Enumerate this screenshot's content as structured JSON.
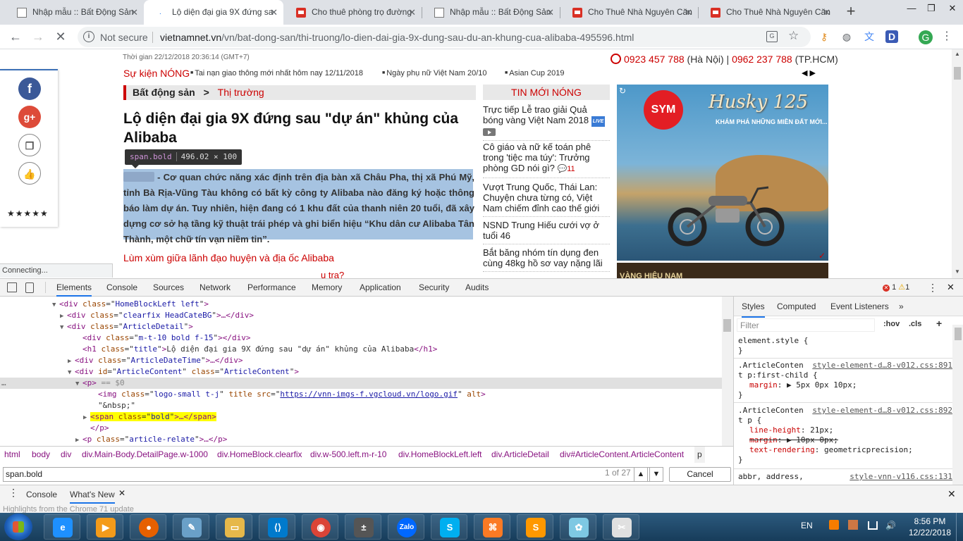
{
  "browser": {
    "tabs": [
      {
        "title": "Nhập mẫu :: Bất Động Sản",
        "favicon": "page-icon",
        "active": false
      },
      {
        "title": "Lộ diện đại gia 9X đứng sa",
        "favicon": "loading-icon",
        "active": true
      },
      {
        "title": "Cho thuê phòng trọ đường",
        "favicon": "red-site-icon",
        "active": false
      },
      {
        "title": "Nhập mẫu :: Bất Động Sản",
        "favicon": "page-icon",
        "active": false
      },
      {
        "title": "Cho Thuê Nhà Nguyên Căn",
        "favicon": "red-site-icon",
        "active": false
      },
      {
        "title": "Cho Thuê Nhà Nguyên Căn",
        "favicon": "red-site-icon",
        "active": false
      }
    ],
    "new_tab_label": "+",
    "window_controls": [
      "—",
      "❐",
      "✕"
    ],
    "security_text": "Not secure",
    "url_domain": "vietnamnet.vn",
    "url_path": "/vn/bat-dong-san/thi-truong/lo-dien-dai-gia-9x-dung-sau-du-an-khung-cua-alibaba-495596.html",
    "profile_initial": "G",
    "ext_d": "D",
    "status_text": "Connecting..."
  },
  "site": {
    "timeline": "Thời gian 22/12/2018 20:36:14 (GMT+7)",
    "hotline_hn": "0923 457 788",
    "hotline_hn_city": " (Hà Nội) | ",
    "hotline_hcm": "0962 237 788",
    "hotline_hcm_city": " (TP.HCM)",
    "su_kien": "Sự kiện NÓNG",
    "events": [
      "Tai nạn giao thông mới nhất hôm nay 12/11/2018",
      "Ngày phụ nữ Việt Nam 20/10",
      "Asian Cup 2019"
    ],
    "carousel_arrows": "◀ ▶",
    "breadcrumb_main": "Bất động sản",
    "breadcrumb_sep": ">",
    "breadcrumb_sub": "Thị trường",
    "title": "Lộ diện đại gia 9X đứng sau \"dự án\" khủng của Alibaba",
    "lead": " - Cơ quan chức năng xác định trên địa bàn xã Châu Pha, thị xã Phú Mỹ, tỉnh Bà Rịa-Vũng Tàu không có bất kỳ công ty Alibaba nào đăng ký hoặc thông báo làm dự án. Tuy nhiên, hiện đang có 1 khu đất của thanh niên 20 tuổi, đã xây dựng cơ sở hạ tầng kỹ thuật trái phép và ghi biển hiệu “Khu dân cư Alibaba Tân Thành, một chữ tín vạn niềm tin”.",
    "related_1": "Lùm xùm giữa lãnh đạo huyện và địa ốc Alibaba",
    "related_2": "u tra?",
    "social_stars": "★★★★★",
    "social_fb": "f",
    "social_gplus": "g+",
    "hot_news_header": "TIN MỚI NÓNG",
    "hot_news": [
      {
        "text": "Trực tiếp Lễ trao giải Quả bóng vàng Việt Nam 2018",
        "badge": "LIVE"
      },
      {
        "text": "Cô giáo và nữ kế toán phê trong 'tiệc ma túy': Trưởng phòng GD nói gì?",
        "comments": "11"
      },
      {
        "text": "Vượt Trung Quốc, Thái Lan: Chuyện chưa từng có, Việt Nam chiếm đỉnh cao thế giới"
      },
      {
        "text": "NSND Trung Hiếu cưới vợ ở tuổi 46"
      },
      {
        "text": "Bắt băng nhóm tín dụng đen cùng 48kg hồ sơ vay nặng lãi"
      }
    ],
    "ad_brand": "SYM",
    "ad_model": "Husky 125",
    "ad_slogan": "KHÁM PHÁ NHỮNG MIỀN ĐẤT MỚI...",
    "ad2_text": "VÀNG HIỆU NAM"
  },
  "inspect_tooltip": {
    "selector": "span.bold",
    "size": "496.02 × 100"
  },
  "devtools": {
    "tabs": [
      "Elements",
      "Console",
      "Sources",
      "Network",
      "Performance",
      "Memory",
      "Application",
      "Security",
      "Audits"
    ],
    "errors": "1",
    "warnings": "1",
    "dom_lines": [
      {
        "indent": 6,
        "tri": "▼",
        "tag": "div",
        "attrs": [
          [
            "class",
            "HomeBlockLeft left"
          ]
        ],
        "tail": ">"
      },
      {
        "indent": 7,
        "tri": "▶",
        "tag": "div",
        "attrs": [
          [
            "class",
            "clearfix HeadCateBG"
          ]
        ],
        "tail": ">…</div>"
      },
      {
        "indent": 7,
        "tri": "▼",
        "tag": "div",
        "attrs": [
          [
            "class",
            "ArticleDetail"
          ]
        ],
        "tail": ">"
      },
      {
        "indent": 9,
        "tri": "",
        "tag": "div",
        "attrs": [
          [
            "class",
            "m-t-10 bold f-15"
          ]
        ],
        "tail": "></div>"
      },
      {
        "indent": 9,
        "tri": "",
        "tag": "h1",
        "attrs": [
          [
            "class",
            "title"
          ]
        ],
        "tail": ">Lộ diện đại gia 9X đứng sau \"dự án\" khủng của Alibaba</h1>"
      },
      {
        "indent": 8,
        "tri": "▶",
        "tag": "div",
        "attrs": [
          [
            "class",
            "ArticleDateTime"
          ]
        ],
        "tail": ">…</div>"
      },
      {
        "indent": 8,
        "tri": "▼",
        "tag": "div",
        "attrs": [
          [
            "id",
            "ArticleContent"
          ],
          [
            "class",
            "ArticleContent"
          ]
        ],
        "tail": ">"
      },
      {
        "indent": 9,
        "tri": "▼",
        "tag": "p",
        "attrs": [],
        "tail": "> == $0",
        "selected": true
      },
      {
        "indent": 11,
        "tri": "",
        "tag": "img",
        "attrs": [
          [
            "class",
            "logo-small t-j"
          ],
          [
            "title",
            ""
          ],
          [
            "src",
            "https://vnn-imgs-f.vgcloud.vn/logo.gif"
          ],
          [
            "alt",
            ""
          ]
        ],
        "tail": ">"
      },
      {
        "indent": 11,
        "tri": "",
        "text": "\"&nbsp;\""
      },
      {
        "indent": 10,
        "tri": "▶",
        "tag": "span",
        "attrs": [
          [
            "class",
            "bold"
          ]
        ],
        "tail": ">…</span>",
        "hover": true
      },
      {
        "indent": 10,
        "tri": "",
        "text": "</p>"
      },
      {
        "indent": 9,
        "tri": "▶",
        "tag": "p",
        "attrs": [
          [
            "class",
            "article-relate"
          ]
        ],
        "tail": ">…</p>"
      }
    ],
    "breadcrumbs": [
      "html",
      "body",
      "div",
      "div.Main-Body.DetailPage.w-1000",
      "div.HomeBlock.clearfix",
      "div.w-500.left.m-r-10",
      "div.HomeBlockLeft.left",
      "div.ArticleDetail",
      "div#ArticleContent.ArticleContent",
      "p"
    ],
    "search_value": "span.bold",
    "search_count": "1 of 27",
    "cancel_label": "Cancel",
    "styles_tabs": [
      "Styles",
      "Computed",
      "Event Listeners"
    ],
    "filter_placeholder": "Filter",
    "hov": ":hov",
    "cls": ".cls",
    "rules": [
      {
        "selector": "element.style {",
        "src": "",
        "props": [],
        "close": "}"
      },
      {
        "selector": ".ArticleConten",
        "selector2": "t p:first-child {",
        "src": "style-element-d…8-v012.css:891",
        "props": [
          {
            "name": "margin",
            "value": "▶ 5px 0px 10px;",
            "strike": false
          }
        ],
        "close": "}"
      },
      {
        "selector": ".ArticleConten",
        "selector2": "t p {",
        "src": "style-element-d…8-v012.css:892",
        "props": [
          {
            "name": "line-height",
            "value": "21px;",
            "strike": false
          },
          {
            "name": "margin",
            "value": "▶ 10px 0px;",
            "strike": true
          },
          {
            "name": "text-rendering",
            "value": "geometricprecision;",
            "strike": false
          }
        ],
        "close": "}"
      },
      {
        "selector": "abbr, address,",
        "src": "style-vnn-v116.css:131",
        "props": [],
        "close": ""
      }
    ],
    "drawer_tabs": [
      "Console",
      "What's New"
    ],
    "drawer_peek": "Highlights from the Chrome 71 update"
  },
  "taskbar": {
    "apps": [
      "ie-icon",
      "media-player-icon",
      "firefox-icon",
      "notepad-icon",
      "explorer-icon",
      "vscode-icon",
      "chrome-icon",
      "calculator-icon",
      "zalo-icon",
      "skype-icon",
      "xampp-icon",
      "sublime-icon",
      "paint-icon",
      "snipping-icon"
    ],
    "zalo_label": "Zalo",
    "lang": "EN",
    "time": "8:56 PM",
    "date": "12/22/2018"
  }
}
